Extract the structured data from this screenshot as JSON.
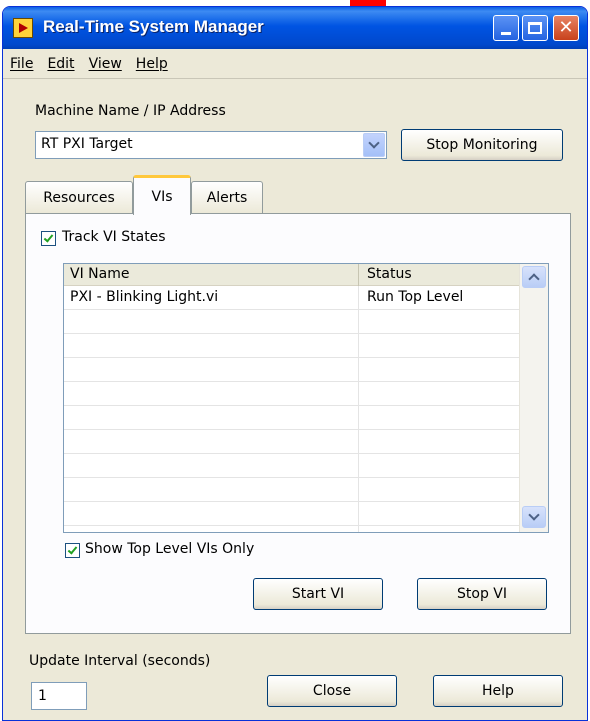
{
  "window": {
    "title": "Real-Time System Manager",
    "close_glyph": "✕"
  },
  "menu": {
    "items": [
      "File",
      "Edit",
      "View",
      "Help"
    ]
  },
  "machine": {
    "label": "Machine Name / IP Address",
    "value": "RT PXI Target",
    "stop_monitoring_label": "Stop Monitoring"
  },
  "tabs": [
    {
      "label": "Resources",
      "active": false
    },
    {
      "label": "VIs",
      "active": true
    },
    {
      "label": "Alerts",
      "active": false
    }
  ],
  "vis_panel": {
    "track_states_label": "Track VI States",
    "track_states_checked": true,
    "columns": [
      "VI Name",
      "Status"
    ],
    "rows": [
      {
        "name": "PXI - Blinking Light.vi",
        "status": "Run Top Level"
      }
    ],
    "show_top_level_label": "Show Top Level VIs Only",
    "show_top_level_checked": true,
    "start_label": "Start VI",
    "stop_label": "Stop VI"
  },
  "footer": {
    "interval_label": "Update Interval (seconds)",
    "interval_value": "1",
    "close_label": "Close",
    "help_label": "Help"
  },
  "icons": [
    "app-icon",
    "minimize-icon",
    "maximize-icon",
    "close-icon",
    "chevron-down-icon",
    "chevron-up-icon",
    "checkmark-icon"
  ],
  "colors": {
    "titlebar": "#0054e3",
    "close_button": "#c8411c",
    "dialog_face": "#ece9d8",
    "active_tab_accent": "#ffc83c",
    "check": "#21a121"
  }
}
